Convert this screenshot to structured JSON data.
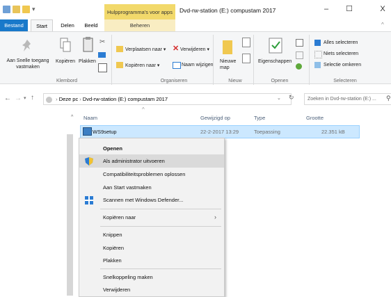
{
  "window": {
    "context_tab": "Hulpprogramma's voor apps",
    "title": "Dvd-rw-station (E:) compustam 2017",
    "minimize": "–",
    "maximize": "☐",
    "close": "X"
  },
  "tabs": {
    "bestand": "Bestand",
    "start": "Start",
    "delen": "Delen",
    "beeld": "Beeld",
    "beheren": "Beheren"
  },
  "ribbon": {
    "pin_quick_access": "Aan Snelle toegang vastmaken",
    "copy": "Kopiëren",
    "paste": "Plakken",
    "klembord": "Klembord",
    "move_to": "Verplaatsen naar ▾",
    "copy_to": "Kopiëren naar ▾",
    "delete": "Verwijderen ▾",
    "rename": "Naam wijzigen",
    "organiseren": "Organiseren",
    "new_folder": "Nieuwe map",
    "nieuw": "Nieuw",
    "properties": "Eigenschappen",
    "openen": "Openen",
    "select_all": "Alles selecteren",
    "select_none": "Niets selecteren",
    "invert_selection": "Selectie omkeren",
    "selecteren": "Selecteren"
  },
  "address": {
    "path_root": "Deze pc",
    "path_sep": "›",
    "path_drive": "Dvd-rw-station (E:) compustam 2017",
    "search_placeholder": "Zoeken in Dvd-rw-station (E:) ..."
  },
  "list": {
    "headers": {
      "name": "Naam",
      "modified": "Gewijzigd op",
      "type": "Type",
      "size": "Grootte"
    },
    "rows": [
      {
        "name": "WS9setup",
        "modified": "22-2-2017 13:29",
        "type": "Toepassing",
        "size": "22.351 kB"
      }
    ]
  },
  "context_menu": {
    "open": "Openen",
    "run_as_admin": "Als administrator uitvoeren",
    "compat": "Compatibiliteitsproblemen oplossen",
    "pin_start": "Aan Start vastmaken",
    "defender": "Scannen met Windows Defender...",
    "copy_to": "Kopiëren naar",
    "cut": "Knippen",
    "copy": "Kopiëren",
    "paste": "Plakken",
    "shortcut": "Snelkoppeling maken",
    "delete": "Verwijderen"
  },
  "colors": {
    "accent": "#1979ca",
    "context_tab": "#f2d96b",
    "selection": "#cce8ff"
  }
}
